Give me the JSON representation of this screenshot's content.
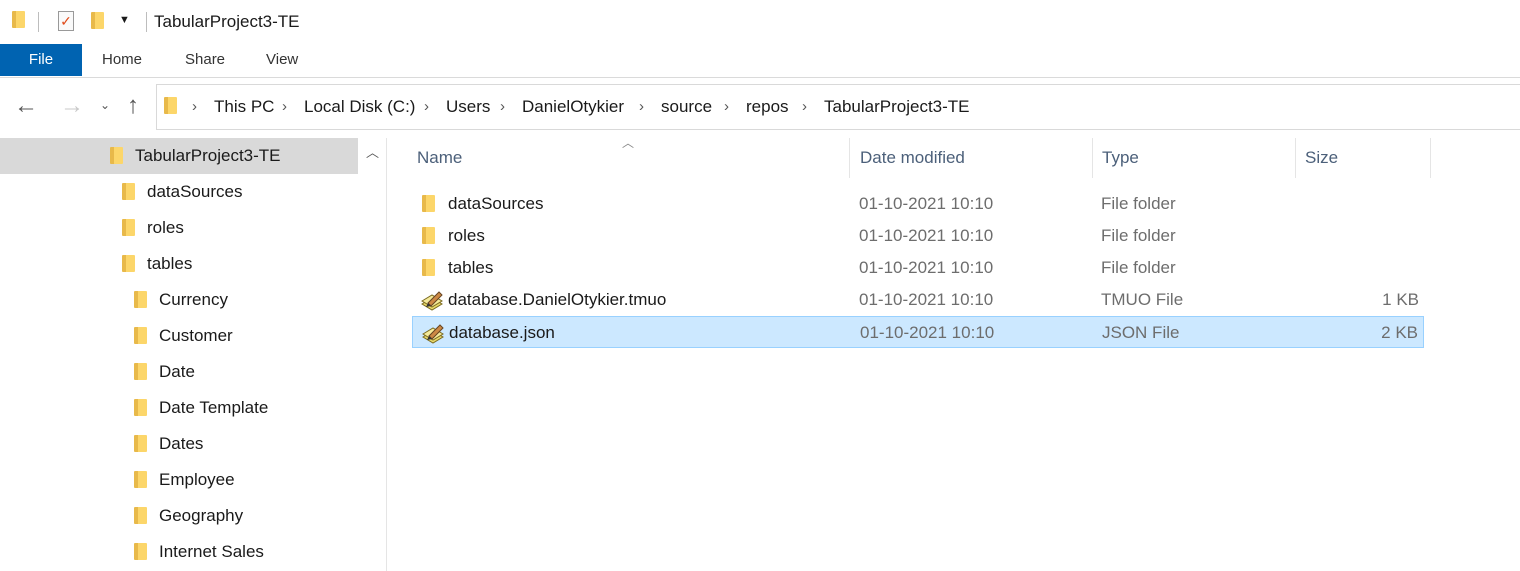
{
  "window": {
    "title": "TabularProject3-TE"
  },
  "ribbon": {
    "tabs": [
      "File",
      "Home",
      "Share",
      "View"
    ],
    "accent": "#0063b1"
  },
  "address": {
    "crumbs": [
      "This PC",
      "Local Disk (C:)",
      "Users",
      "DanielOtykier",
      "source",
      "repos",
      "TabularProject3-TE"
    ]
  },
  "nav": {
    "items": [
      {
        "label": "TabularProject3-TE",
        "level": 0,
        "selected": true
      },
      {
        "label": "dataSources",
        "level": 1
      },
      {
        "label": "roles",
        "level": 1
      },
      {
        "label": "tables",
        "level": 1
      },
      {
        "label": "Currency",
        "level": 2
      },
      {
        "label": "Customer",
        "level": 2
      },
      {
        "label": "Date",
        "level": 2
      },
      {
        "label": "Date Template",
        "level": 2
      },
      {
        "label": "Dates",
        "level": 2
      },
      {
        "label": "Employee",
        "level": 2
      },
      {
        "label": "Geography",
        "level": 2
      },
      {
        "label": "Internet Sales",
        "level": 2
      }
    ]
  },
  "columns": {
    "name": "Name",
    "date": "Date modified",
    "type": "Type",
    "size": "Size"
  },
  "files": [
    {
      "name": "dataSources",
      "date": "01-10-2021 10:10",
      "type": "File folder",
      "size": "",
      "icon": "folder-icon"
    },
    {
      "name": "roles",
      "date": "01-10-2021 10:10",
      "type": "File folder",
      "size": "",
      "icon": "folder-icon"
    },
    {
      "name": "tables",
      "date": "01-10-2021 10:10",
      "type": "File folder",
      "size": "",
      "icon": "folder-icon"
    },
    {
      "name": "database.DanielOtykier.tmuo",
      "date": "01-10-2021 10:10",
      "type": "TMUO File",
      "size": "1 KB",
      "icon": "notepad-file-icon"
    },
    {
      "name": "database.json",
      "date": "01-10-2021 10:10",
      "type": "JSON File",
      "size": "2 KB",
      "icon": "notepad-file-icon",
      "selected": true
    }
  ]
}
